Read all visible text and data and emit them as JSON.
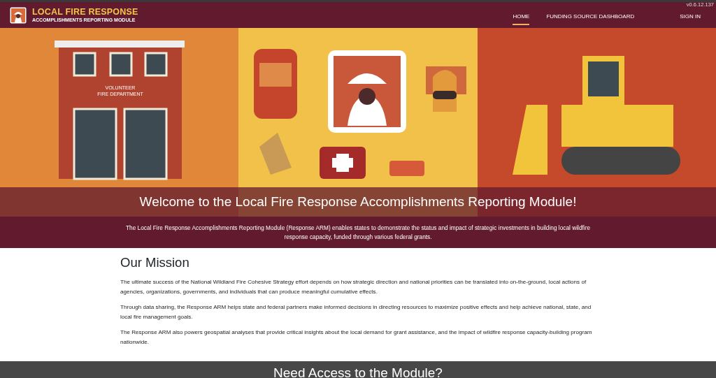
{
  "brand": {
    "title": "LOCAL FIRE RESPONSE",
    "subtitle": "ACCOMPLISHMENTS REPORTING MODULE"
  },
  "nav": [
    {
      "label": "HOME",
      "selected": true
    },
    {
      "label": "FUNDING SOURCE DASHBOARD",
      "selected": false
    }
  ],
  "sign_in": "SIGN IN",
  "version": "v0.6.12.137",
  "hero": {
    "title": "Welcome to the Local Fire Response Accomplishments Reporting Module!",
    "station_sign": "VOLUNTEER\nFIRE DEPARTMENT"
  },
  "intro": "The Local Fire Response Accomplishments Reporting Module (Response ARM) enables states to demonstrate the status and impact of strategic investments in building local wildfire response capacity, funded through various federal grants.",
  "mission": {
    "heading": "Our Mission",
    "paragraphs": [
      "The ultimate success of the National Wildland Fire Cohesive Strategy effort depends on how strategic direction and national priorities can be translated into on-the-ground, local actions of agencies, organizations, governments, and individuals that can produce meaningful cumulative effects.",
      "Through data sharing, the Response ARM helps state and federal partners make informed decisions in directing resources to maximize positive effects and help achieve national, state, and local fire management goals.",
      "The Response ARM also powers geospatial analyses that provide critical insights about the local demand for grant assistance, and the impact of wildfire response capacity-building program nationwide."
    ]
  },
  "access": {
    "heading": "Need Access to the Module?"
  }
}
